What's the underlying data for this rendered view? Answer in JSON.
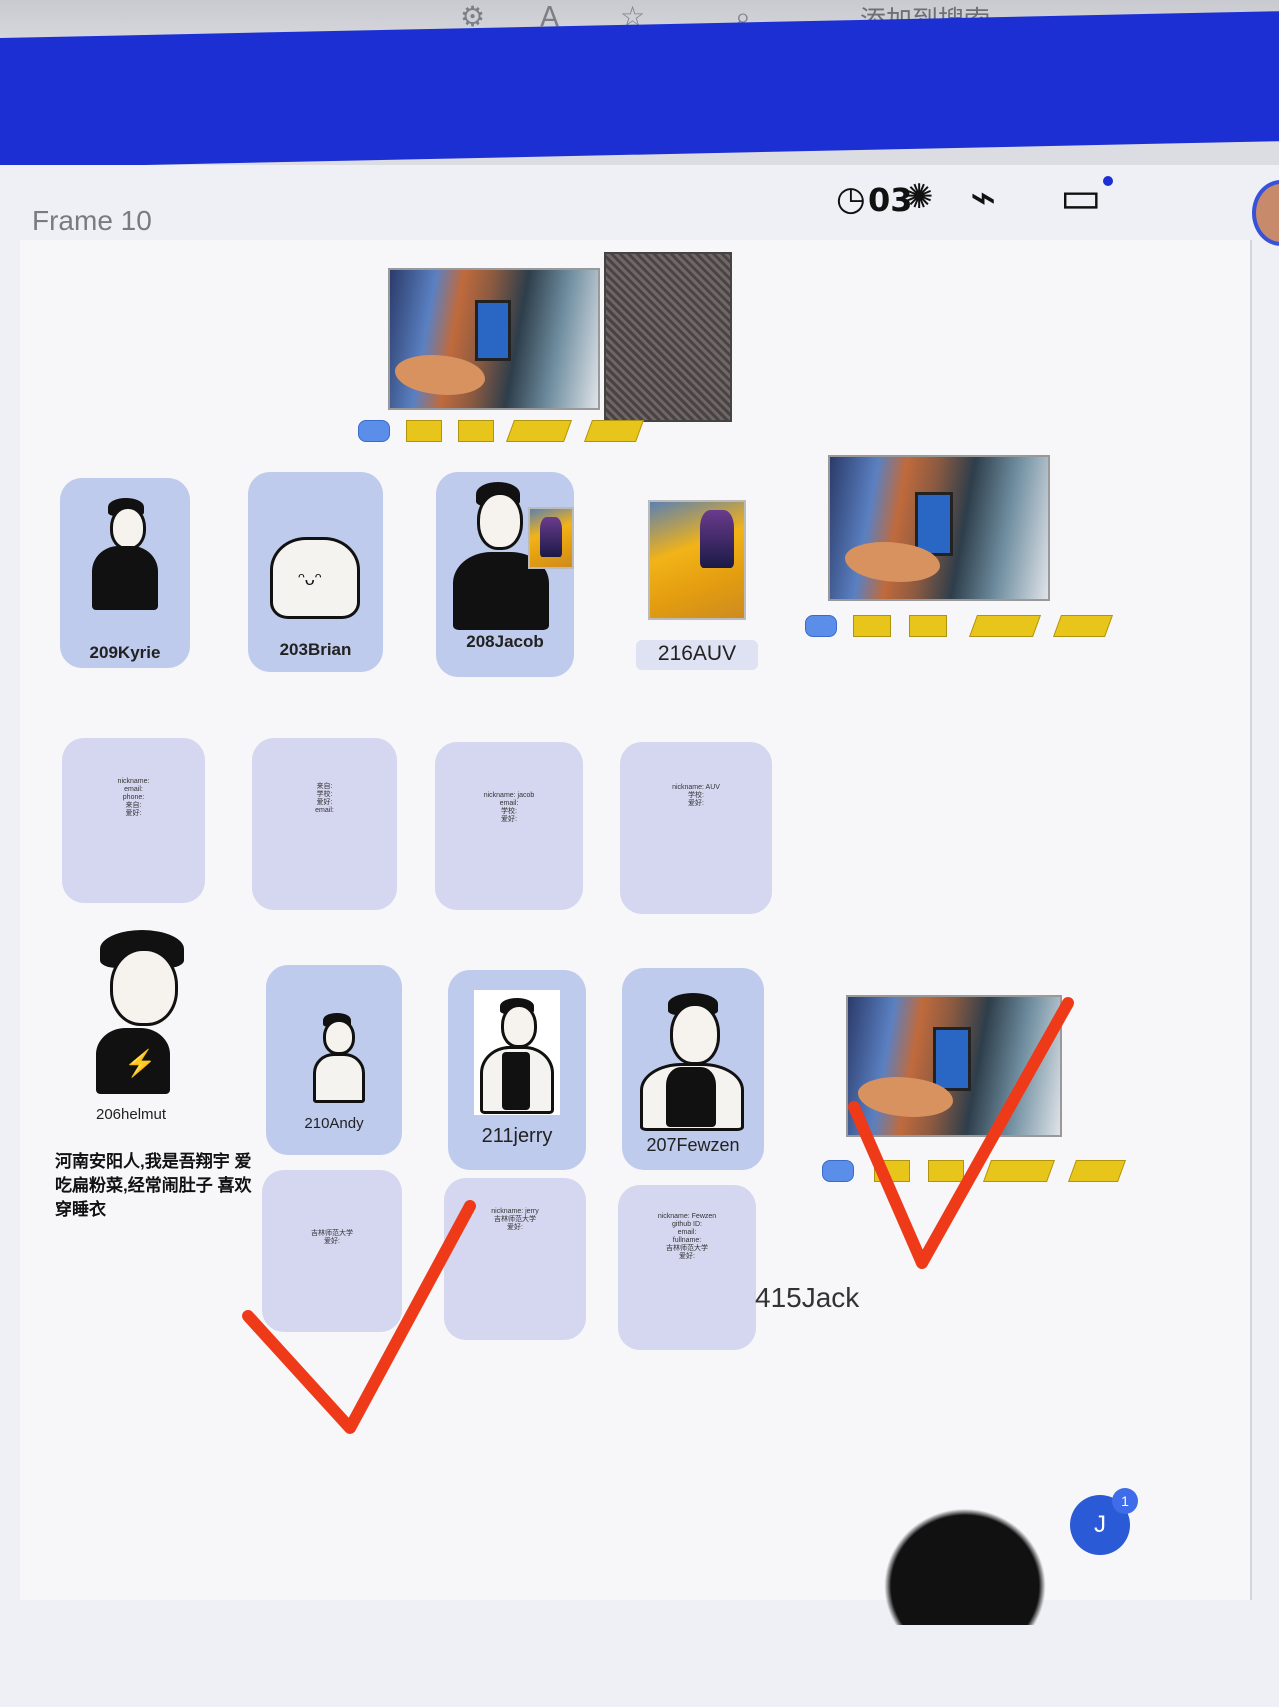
{
  "browser": {
    "address_text": "添加到搜索"
  },
  "frame": {
    "title": "Frame 10"
  },
  "toolbar": {
    "timer_text": "03"
  },
  "students": [
    {
      "label": "209Kyrie"
    },
    {
      "label": "203Brian"
    },
    {
      "label": "208Jacob"
    },
    {
      "label": "216AUV"
    },
    {
      "label": "206helmut"
    },
    {
      "label": "210Andy"
    },
    {
      "label": "211jerry"
    },
    {
      "label": "207Fewzen"
    },
    {
      "label": "415Jack"
    }
  ],
  "bio": {
    "text": "河南安阳人,我是吾翔宇 爱吃扁粉菜,经常闹肚子 喜欢穿睡衣"
  },
  "info_cards": [
    {
      "text": "nickname:\nemail:\nphone:\n来自:\n爱好:"
    },
    {
      "text": "来自:\n学校:\n爱好:\nemail:"
    },
    {
      "text": "nickname: jacob\nemail:\n学校:\n爱好:"
    },
    {
      "text": "nickname: AUV\n学校:\n爱好:"
    },
    {
      "text": "吉林师范大学\n爱好:"
    },
    {
      "text": "nickname: jerry\n吉林师范大学\n爱好:"
    },
    {
      "text": "nickname: Fewzen\ngithub ID:\nemail:\nfullname:\n吉林师范大学\n爱好:"
    }
  ],
  "notification": {
    "initial": "J",
    "count": "1"
  }
}
